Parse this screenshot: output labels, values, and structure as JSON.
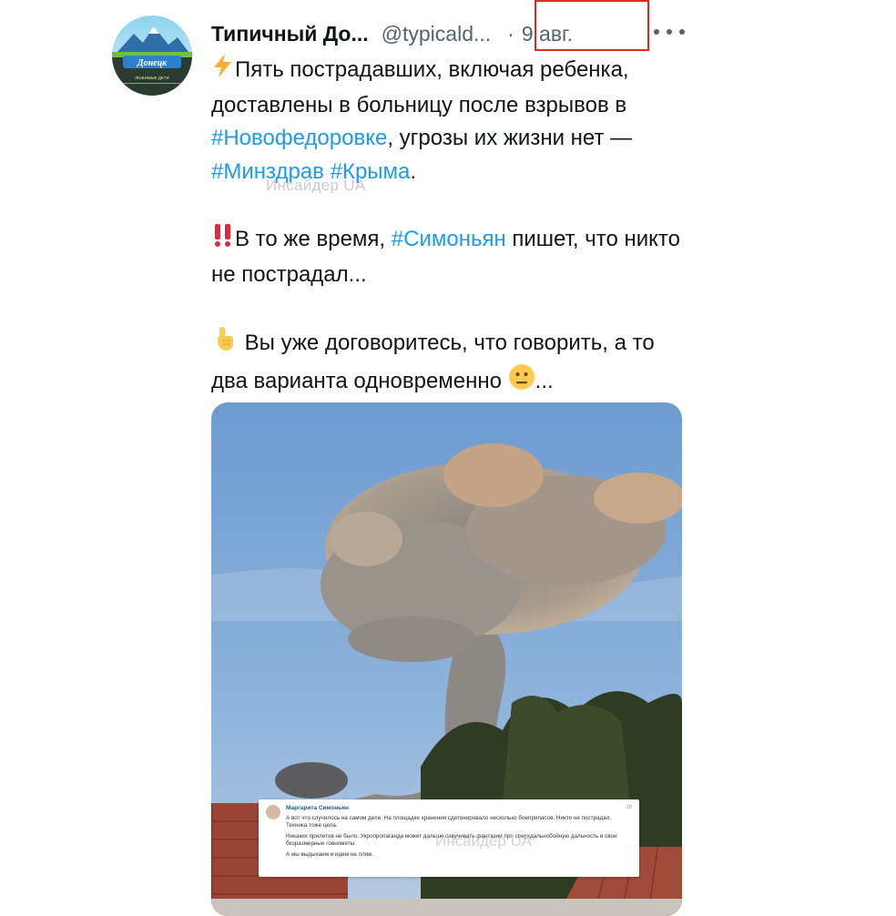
{
  "author": {
    "name": "Типичный До...",
    "handle": "@typicald...",
    "avatar_lines": [
      "Донецк",
      "ЛЮБИМЫЕ ДЕТИ"
    ]
  },
  "meta": {
    "separator": "·",
    "date": "9 авг."
  },
  "tweet": {
    "line1_pre": "Пять пострадавших, включая ребенка, доставлены в больницу после взрывов в ",
    "line1_tag1": "#Новофедоровке",
    "line1_mid": ", угрозы их жизни нет — ",
    "line1_tag2": "#Минздрав",
    "line1_space": " ",
    "line1_tag3": "#Крыма",
    "line1_end": ".",
    "watermark": "Инсайдер UA",
    "line2_pre": "В то же время, ",
    "line2_tag": "#Симоньян",
    "line2_post": " пишет, что никто не пострадал...",
    "line3_pre": "Вы уже договоритесь, что говорить, а то два варианта одновременно ",
    "line3_post": "..."
  },
  "media": {
    "card_author": "Маргарита Симоньян",
    "card_num": "28",
    "card_line1": "А вот что случилось на самом деле. На площадке хранения сдетонировало несколько боеприпасов. Никто не пострадал. Техника тоже цела.",
    "card_line2": "Никаких прилетов не было. Укропропаганда может дальше озвучивать фантазии про сверхдальнобойную дальность в свои безразмерные говнометы.",
    "card_line3": "А мы выдыхаем и идем на пляж.",
    "card_watermark": "Инсайдер UA"
  },
  "icons": {
    "lightning": "lightning-emoji",
    "exclamation": "double-exclamation-emoji",
    "pointing": "pointing-up-emoji",
    "neutral": "neutral-face-emoji",
    "more": "more-icon"
  },
  "colors": {
    "hashtag": "#1d9bf0",
    "secondary": "#536471",
    "highlight_box": "#e0281c"
  }
}
